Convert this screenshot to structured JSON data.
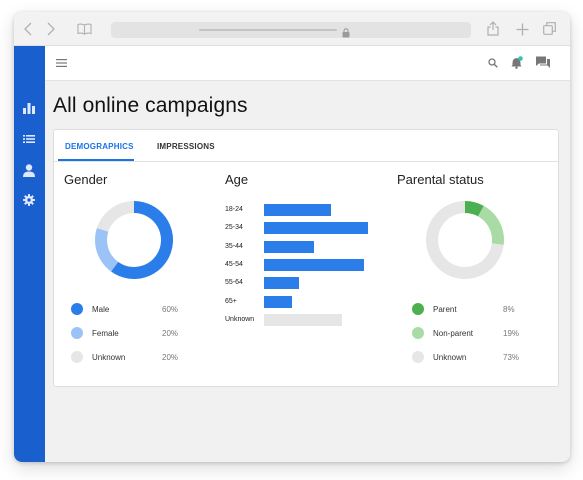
{
  "page": {
    "title": "All online campaigns"
  },
  "tabs": [
    {
      "label": "DEMOGRAPHICS",
      "active": true
    },
    {
      "label": "IMPRESSIONS",
      "active": false
    }
  ],
  "gender": {
    "title": "Gender",
    "items": [
      {
        "label": "Male",
        "value": "60%",
        "percent": 60,
        "color": "#2b7de9"
      },
      {
        "label": "Female",
        "value": "20%",
        "percent": 20,
        "color": "#9cc3f5"
      },
      {
        "label": "Unknown",
        "value": "20%",
        "percent": 20,
        "color": "#e6e6e6"
      }
    ]
  },
  "age": {
    "title": "Age",
    "bar_color": "#2b7de9",
    "unknown_color": "#e6e6e6",
    "rows": [
      {
        "label": "18-24",
        "value": 18
      },
      {
        "label": "25-34",
        "value": 28
      },
      {
        "label": "35-44",
        "value": 13.5
      },
      {
        "label": "45-54",
        "value": 27
      },
      {
        "label": "55-64",
        "value": 9.5
      },
      {
        "label": "65+",
        "value": 7.5
      },
      {
        "label": "Unknown",
        "value": 21
      }
    ],
    "max": 28
  },
  "parental": {
    "title": "Parental status",
    "items": [
      {
        "label": "Parent",
        "value": "8%",
        "percent": 8,
        "color": "#4caf50"
      },
      {
        "label": "Non-parent",
        "value": "19%",
        "percent": 19,
        "color": "#a9dba4"
      },
      {
        "label": "Unknown",
        "value": "73%",
        "percent": 73,
        "color": "#e6e6e6"
      }
    ]
  },
  "icons": {
    "browser": [
      "back-icon",
      "forward-icon",
      "book-icon",
      "lock-icon",
      "share-icon",
      "new-tab-icon",
      "tabs-icon"
    ],
    "rail": [
      "bar-chart-icon",
      "list-icon",
      "person-icon",
      "gear-icon"
    ],
    "header": [
      "menu-icon",
      "search-icon",
      "notifications-icon",
      "feedback-icon"
    ],
    "notification_dot_color": "#2ec4b6"
  }
}
